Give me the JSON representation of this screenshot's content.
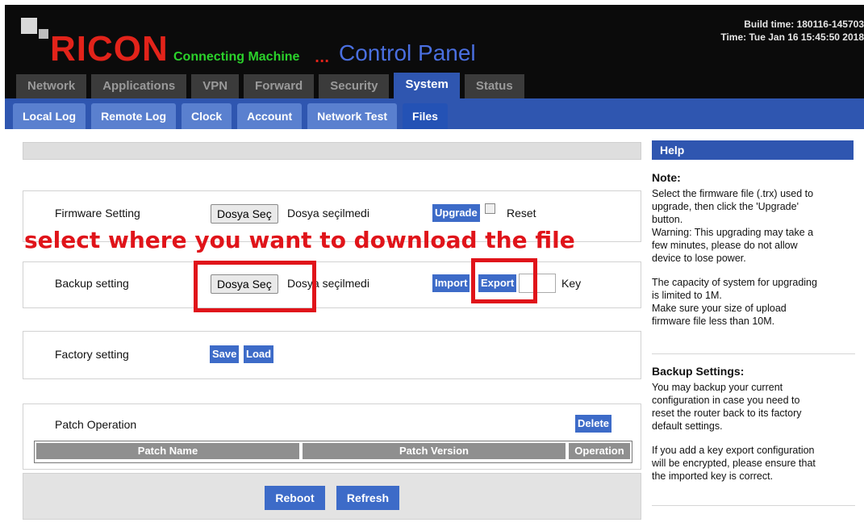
{
  "header": {
    "logo": "RICON",
    "tagline": "Connecting Machine",
    "dots": "...",
    "title": "Control Panel",
    "build_time": "Build time: 180116-145703",
    "time": "Time: Tue Jan 16 15:45:50 2018"
  },
  "main_tabs": [
    "Network",
    "Applications",
    "VPN",
    "Forward",
    "Security",
    "System",
    "Status"
  ],
  "sub_tabs": [
    "Local Log",
    "Remote Log",
    "Clock",
    "Account",
    "Network Test",
    "Files"
  ],
  "firmware": {
    "label": "Firmware Setting",
    "file_button": "Dosya Seç",
    "file_status": "Dosya seçilmedi",
    "upgrade": "Upgrade",
    "reset": "Reset"
  },
  "backup": {
    "label": "Backup setting",
    "file_button": "Dosya Seç",
    "file_status": "Dosya seçilmedi",
    "import": "Import",
    "export": "Export",
    "key": "Key"
  },
  "factory": {
    "label": "Factory setting",
    "save": "Save",
    "load": "Load"
  },
  "patch": {
    "label": "Patch Operation",
    "delete": "Delete",
    "columns": [
      "Patch Name",
      "Patch Version",
      "Operation"
    ]
  },
  "footer": {
    "reboot": "Reboot",
    "refresh": "Refresh"
  },
  "help": {
    "title": "Help",
    "note_heading": "Note:",
    "note_lines": [
      "Select the firmware file (.trx) used to",
      "upgrade, then click the 'Upgrade'",
      "button.",
      "Warning: This upgrading may take a",
      "few minutes, please do not allow",
      "device to lose power.",
      "",
      "The capacity of system for upgrading",
      "is limited to 1M.",
      "Make sure your size of upload",
      "firmware file less than 10M."
    ],
    "backup_heading": "Backup Settings:",
    "backup_lines": [
      "You may backup your current",
      "configuration in case you need to",
      "reset the router back to its factory",
      "default settings.",
      "",
      "If you add a key export configuration",
      "will be encrypted, please ensure that",
      "the imported key is correct."
    ]
  },
  "annotation": "select where you want to download the file",
  "colors": {
    "header_bg": "#0b0b0b",
    "accent_blue": "#2f56b0",
    "logo_red": "#e2231a",
    "annotation_red": "#e0141a"
  }
}
